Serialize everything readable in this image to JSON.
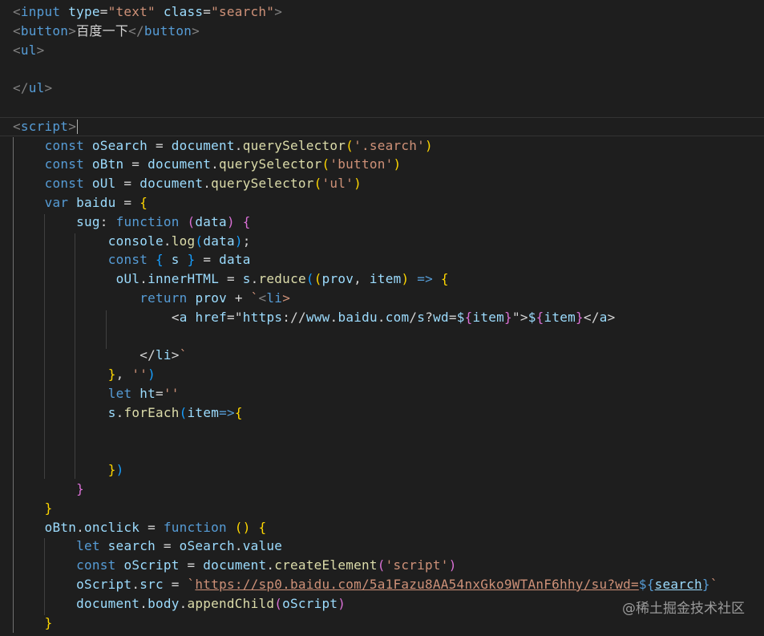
{
  "code_lines": [
    "<input type=\"text\" class=\"search\">",
    "<button>百度一下</button>",
    "<ul>",
    "",
    "</ul>",
    "",
    "<script>",
    "    const oSearch = document.querySelector('.search')",
    "    const oBtn = document.querySelector('button')",
    "    const oUl = document.querySelector('ul')",
    "    var baidu = {",
    "        sug: function (data) {",
    "            console.log(data);",
    "            const { s } = data",
    "             oUl.innerHTML = s.reduce((prov, item) => {",
    "                return prov + `<li>",
    "                    <a href=\"https://www.baidu.com/s?wd=${item}\">${item}</a>",
    "",
    "                </li>`",
    "            }, '')",
    "            let ht=''",
    "            s.forEach(item=>{",
    "",
    "",
    "            })",
    "        }",
    "    }",
    "    oBtn.onclick = function () {",
    "        let search = oSearch.value",
    "        const oScript = document.createElement('script')",
    "        oScript.src = `https://sp0.baidu.com/5a1Fazu8AA54nxGko9WTAnF6hhy/su?wd=${search}`",
    "        document.body.appendChild(oScript)",
    "    }"
  ],
  "watermark": "@稀土掘金技术社区",
  "colors": {
    "background": "#1e1e1e",
    "tag": "#569cd6",
    "attribute": "#9cdcfe",
    "string": "#ce9178",
    "function": "#dcdcaa",
    "bracket_gold": "#ffd700",
    "bracket_orchid": "#da70d6",
    "bracket_blue": "#179fff"
  }
}
